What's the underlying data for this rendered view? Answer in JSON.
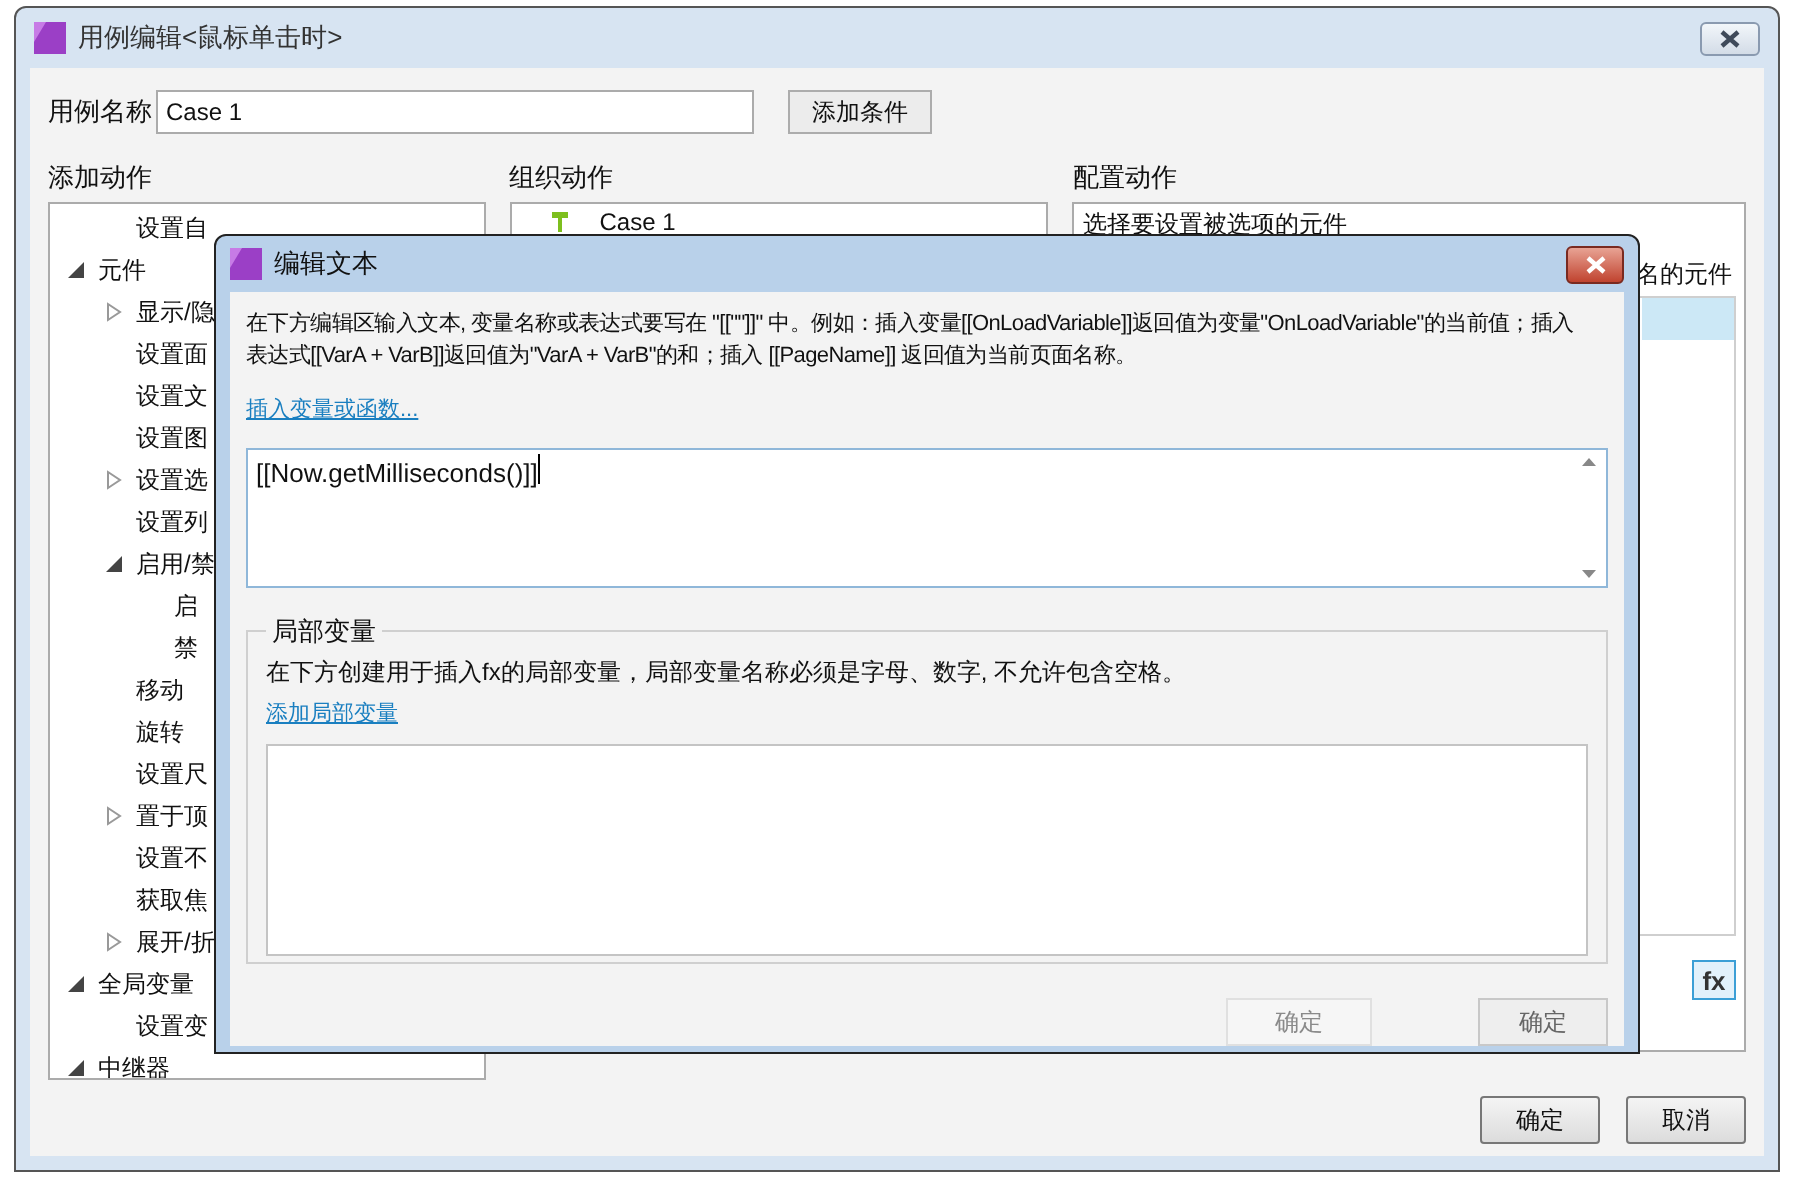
{
  "window": {
    "title": "用例编辑<鼠标单击时>"
  },
  "case_name": {
    "label": "用例名称",
    "value": "Case 1"
  },
  "add_condition_button": "添加条件",
  "add_actions": {
    "heading": "添加动作",
    "tree": [
      {
        "children": [
          {
            "label": "设置自"
          }
        ]
      },
      {
        "label": "元件",
        "expanded": true,
        "children": [
          {
            "label": "显示/隐",
            "expanded": false
          },
          {
            "label": "设置面"
          },
          {
            "label": "设置文"
          },
          {
            "label": "设置图"
          },
          {
            "label": "设置选",
            "expanded": false
          },
          {
            "label": "设置列"
          },
          {
            "label": "启用/禁",
            "expanded": true,
            "children": [
              {
                "label": "启"
              },
              {
                "label": "禁"
              }
            ]
          },
          {
            "label": "移动"
          },
          {
            "label": "旋转"
          },
          {
            "label": "设置尺"
          },
          {
            "label": "置于顶",
            "expanded": false
          },
          {
            "label": "设置不"
          },
          {
            "label": "获取焦"
          },
          {
            "label": "展开/折",
            "expanded": false
          }
        ]
      },
      {
        "label": "全局变量",
        "expanded": true,
        "children": [
          {
            "label": "设置变"
          }
        ]
      },
      {
        "label": "中继器",
        "expanded": true
      }
    ]
  },
  "organize_actions": {
    "heading": "组织动作",
    "case_label": "Case 1"
  },
  "configure_actions": {
    "heading": "配置动作",
    "hint": "选择要设置被选项的元件",
    "column_label": "名的元件",
    "rows": [
      {
        "selected": true
      }
    ]
  },
  "footer_buttons": [
    "确定",
    "取消"
  ],
  "dialog": {
    "title": "编辑文本",
    "description": "在下方编辑区输入文本, 变量名称或表达式要写在 \"[[\"\"]]\" 中。例如：插入变量[[OnLoadVariable]]返回值为变量\"OnLoadVariable\"的当前值；插入表达式[[VarA + VarB]]返回值为\"VarA + VarB\"的和；插入 [[PageName]] 返回值为当前页面名称。",
    "insert_link": "插入变量或函数...",
    "editor_value": "[[Now.getMilliseconds()]]",
    "local_vars": {
      "title": "局部变量",
      "description": "在下方创建用于插入fx的局部变量，局部变量名称必须是字母、数字, 不允许包含空格。",
      "add_link": "添加局部变量"
    },
    "buttons": [
      {
        "label": "确定",
        "disabled": true
      },
      {
        "label": "确定",
        "disabled": false
      }
    ]
  },
  "fx_button": "fx"
}
